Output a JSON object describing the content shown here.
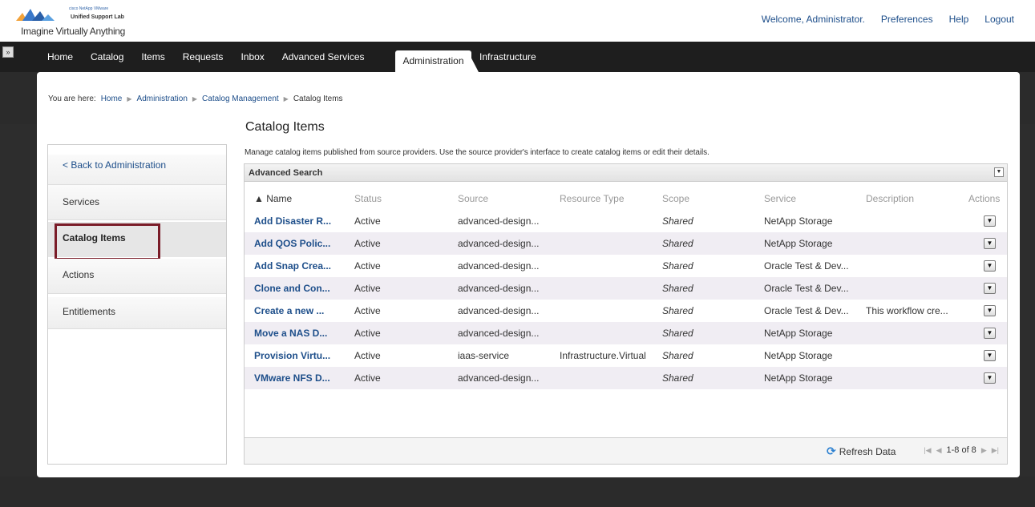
{
  "header": {
    "logo_small": "Unified Support Lab",
    "logo_badges": "cisco  NetApp  VMware",
    "tagline": "Imagine Virtually Anything",
    "links": [
      "Welcome, Administrator.",
      "Preferences",
      "Help",
      "Logout"
    ]
  },
  "nav": {
    "toggle": "»",
    "items": [
      "Home",
      "Catalog",
      "Items",
      "Requests",
      "Inbox",
      "Advanced Services"
    ],
    "active": "Administration",
    "after": "Infrastructure"
  },
  "breadcrumb": {
    "prefix": "You are here:",
    "items": [
      "Home",
      "Administration",
      "Catalog Management",
      "Catalog Items"
    ]
  },
  "page": {
    "title": "Catalog Items",
    "description": "Manage catalog items published from source providers. Use the source provider's interface to create catalog items or edit their details."
  },
  "sidebar": {
    "back": "< Back to Administration",
    "items": [
      "Services",
      "Catalog Items",
      "Actions",
      "Entitlements"
    ]
  },
  "grid": {
    "advanced_search": "Advanced Search",
    "columns": [
      "▲ Name",
      "Status",
      "Source",
      "Resource Type",
      "Scope",
      "Service",
      "Description",
      "Actions"
    ],
    "rows": [
      {
        "name": "Add Disaster R...",
        "status": "Active",
        "source": "advanced-design...",
        "resource": "",
        "scope": "Shared",
        "service": "NetApp Storage",
        "description": ""
      },
      {
        "name": "Add QOS Polic...",
        "status": "Active",
        "source": "advanced-design...",
        "resource": "",
        "scope": "Shared",
        "service": "NetApp Storage",
        "description": ""
      },
      {
        "name": "Add Snap Crea...",
        "status": "Active",
        "source": "advanced-design...",
        "resource": "",
        "scope": "Shared",
        "service": "Oracle Test & Dev...",
        "description": ""
      },
      {
        "name": "Clone and Con...",
        "status": "Active",
        "source": "advanced-design...",
        "resource": "",
        "scope": "Shared",
        "service": "Oracle Test & Dev...",
        "description": ""
      },
      {
        "name": "Create a new ...",
        "status": "Active",
        "source": "advanced-design...",
        "resource": "",
        "scope": "Shared",
        "service": "Oracle Test & Dev...",
        "description": "This workflow cre..."
      },
      {
        "name": "Move a NAS D...",
        "status": "Active",
        "source": "advanced-design...",
        "resource": "",
        "scope": "Shared",
        "service": "NetApp Storage",
        "description": ""
      },
      {
        "name": "Provision Virtu...",
        "status": "Active",
        "source": "iaas-service",
        "resource": "Infrastructure.Virtual",
        "scope": "Shared",
        "service": "NetApp Storage",
        "description": ""
      },
      {
        "name": "VMware NFS D...",
        "status": "Active",
        "source": "advanced-design...",
        "resource": "",
        "scope": "Shared",
        "service": "NetApp Storage",
        "description": ""
      }
    ],
    "refresh": "Refresh Data",
    "pager": "1-8 of 8"
  }
}
